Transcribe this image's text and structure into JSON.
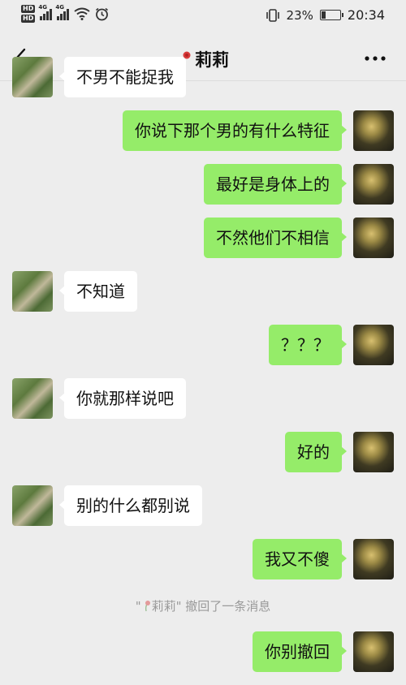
{
  "status_bar": {
    "hd1": "HD",
    "hd2": "HD",
    "net1": "4G",
    "net2": "4G",
    "battery": "23%",
    "time": "20:34"
  },
  "header": {
    "title": "莉莉"
  },
  "messages": [
    {
      "from": "them",
      "text": "不男不能捉我"
    },
    {
      "from": "me",
      "text": "你说下那个男的有什么特征"
    },
    {
      "from": "me",
      "text": "最好是身体上的"
    },
    {
      "from": "me",
      "text": "不然他们不相信"
    },
    {
      "from": "them",
      "text": "不知道"
    },
    {
      "from": "me",
      "text": "？？？"
    },
    {
      "from": "them",
      "text": "你就那样说吧"
    },
    {
      "from": "me",
      "text": "好的"
    },
    {
      "from": "them",
      "text": "别的什么都别说"
    },
    {
      "from": "me",
      "text": "我又不傻"
    },
    {
      "from": "me",
      "text": "你别撤回"
    }
  ],
  "system_notice": {
    "quote_open": "\"",
    "name": "莉莉",
    "quote_close": "\"",
    "text": " 撤回了一条消息"
  },
  "colors": {
    "background": "#ededed",
    "my_bubble": "#95ec69",
    "their_bubble": "#ffffff"
  }
}
